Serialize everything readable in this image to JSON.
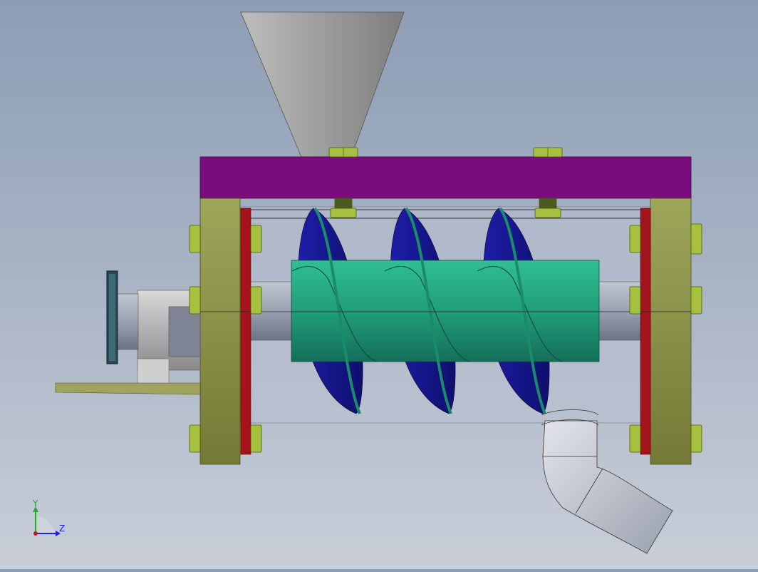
{
  "triad": {
    "y_label": "Y",
    "z_label": "Z",
    "y_color": "#19b219",
    "z_color": "#1a24d8",
    "origin_color": "#c41818"
  },
  "model": {
    "hopper_color": "#9a9a9a",
    "top_beam_color": "#7a0c7c",
    "end_plate_color": "#98a056",
    "flange_color": "#a3141c",
    "shaft_color": "#9ea6b4",
    "screw_core_color": "#229b78",
    "flight_color": "#1a1a9a",
    "bolt_color": "#a8c040",
    "outlet_pipe_color": "#c6cad6"
  }
}
